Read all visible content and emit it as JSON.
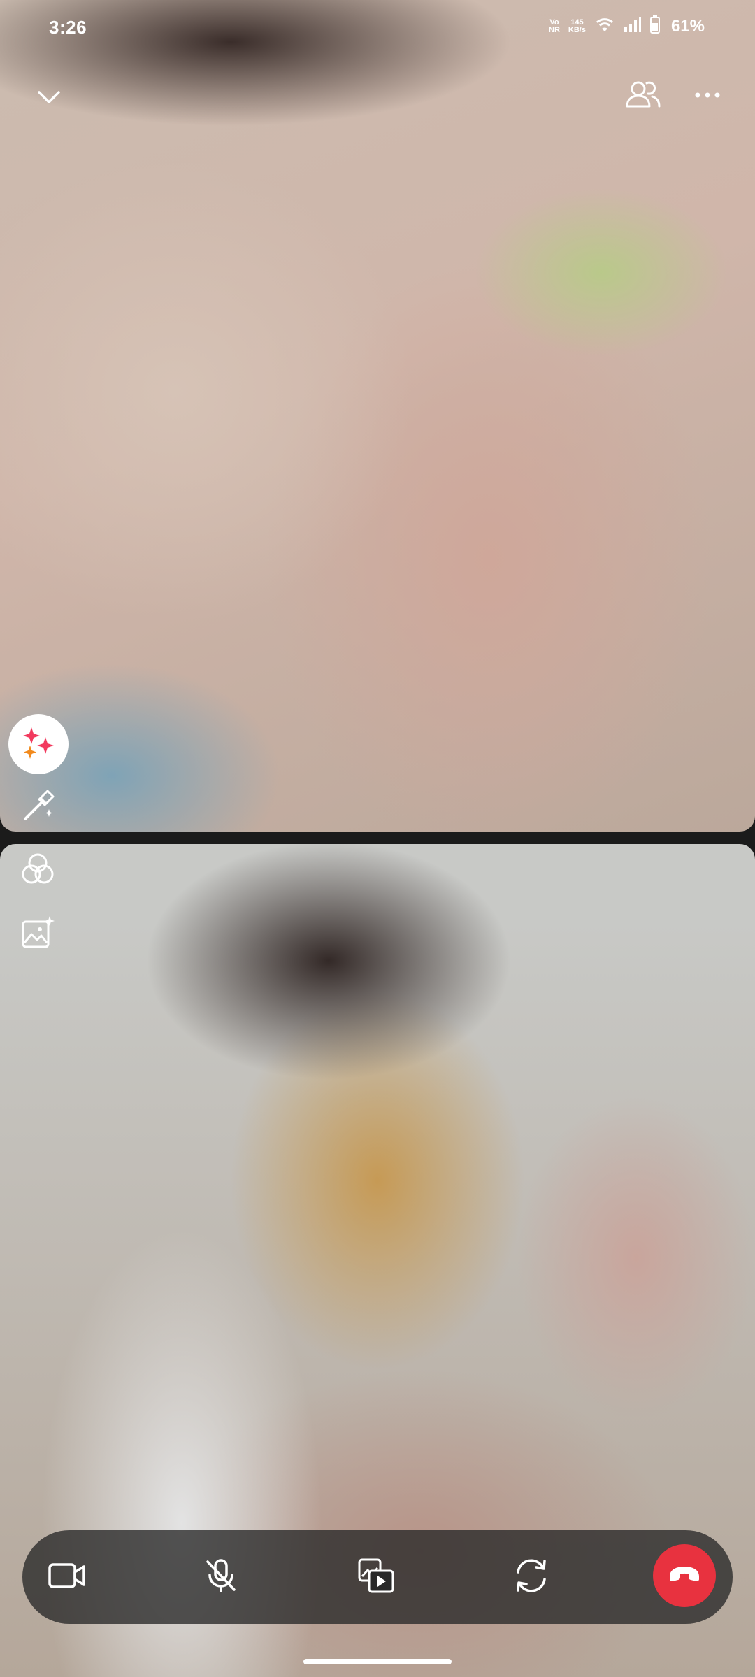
{
  "status_bar": {
    "time": "3:26",
    "network_label_top": "Vo",
    "network_label_bottom": "NR",
    "speed_value": "145",
    "speed_unit": "KB/s",
    "battery": "61%",
    "icons": [
      "wifi-icon",
      "signal-icon",
      "battery-icon"
    ]
  },
  "top_bar": {
    "icons": [
      "chevron-down-icon",
      "people-icon",
      "more-icon"
    ]
  },
  "side_tools": {
    "icons": [
      "sparkles-icon",
      "magic-wand-icon",
      "filters-icon",
      "image-effect-icon"
    ]
  },
  "controls": {
    "icons": [
      "video-camera-icon",
      "microphone-off-icon",
      "media-share-icon",
      "flip-camera-icon",
      "end-call-icon"
    ],
    "end_call_color": "#e8323f"
  },
  "videos": {
    "remote": "remote participant video",
    "local": "self view video"
  }
}
